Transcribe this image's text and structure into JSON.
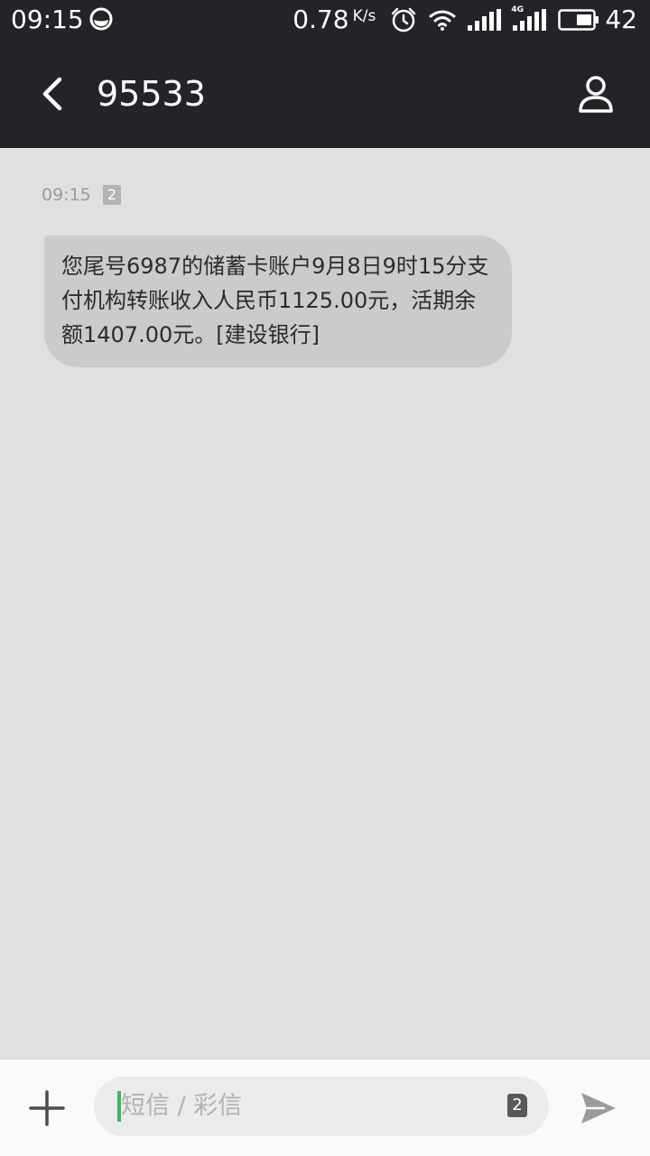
{
  "status_bar": {
    "time": "09:15",
    "net_speed_value": "0.78",
    "net_speed_unit": "K/s",
    "network_type": "4G",
    "battery_level": "42",
    "icons": [
      "message-app-icon",
      "alarm-icon",
      "wifi-icon",
      "signal-icon",
      "signal-4g-icon",
      "battery-icon"
    ]
  },
  "toolbar": {
    "title": "95533",
    "icons": [
      "back-arrow-icon",
      "contact-person-icon"
    ]
  },
  "conversation": {
    "messages": [
      {
        "time": "09:15",
        "sim": "2",
        "text": "您尾号6987的储蓄卡账户9月8日9时15分支付机构转账收入人民币1125.00元，活期余额1407.00元。[建设银行]"
      }
    ]
  },
  "composer": {
    "placeholder": "短信 / 彩信",
    "sim": "2",
    "caret_color": "#3fb565",
    "icons": [
      "plus-icon",
      "send-icon"
    ]
  },
  "colors": {
    "top_bar": "#232427",
    "background": "#dfe0e0",
    "bubble": "#cbcbcb",
    "bottom_bar": "#fafafa"
  }
}
